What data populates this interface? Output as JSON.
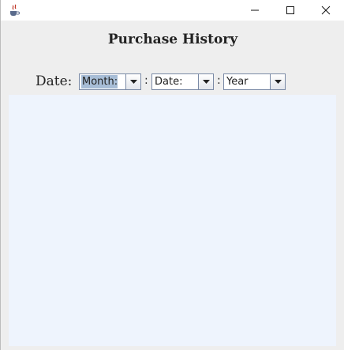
{
  "window": {
    "title": "",
    "icon": "java-cup-icon",
    "controls": {
      "minimize": "minimize-icon",
      "maximize": "maximize-icon",
      "close": "close-icon"
    }
  },
  "heading": "Purchase History",
  "date_filter": {
    "label": "Date:",
    "separator": ":",
    "month": {
      "selected": "Month:"
    },
    "day": {
      "selected": "Date:"
    },
    "year": {
      "selected": "Year"
    }
  },
  "colors": {
    "window_bg": "#eeeeee",
    "content_bg": "#eef4fd",
    "combo_border": "#7a8aa6",
    "selection_bg": "#a7bdd6"
  }
}
